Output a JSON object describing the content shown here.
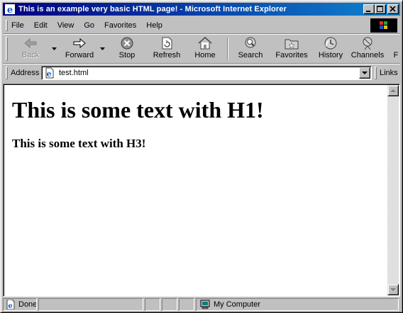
{
  "window": {
    "title": "This is an example very basic HTML page! - Microsoft Internet Explorer"
  },
  "menu": [
    "File",
    "Edit",
    "View",
    "Go",
    "Favorites",
    "Help"
  ],
  "toolbar": {
    "back": "Back",
    "forward": "Forward",
    "stop": "Stop",
    "refresh": "Refresh",
    "home": "Home",
    "search": "Search",
    "favorites": "Favorites",
    "history": "History",
    "channels": "Channels",
    "more": "F"
  },
  "address": {
    "label": "Address",
    "value": "test.html",
    "links": "Links"
  },
  "page": {
    "h1": "This is some text with H1!",
    "h3": "This is some text with H3!"
  },
  "status": {
    "text": "Done",
    "zone": "My Computer"
  },
  "colors": {
    "titlebar_start": "#000080",
    "titlebar_end": "#1084d0",
    "chrome": "#c0c0c0"
  }
}
